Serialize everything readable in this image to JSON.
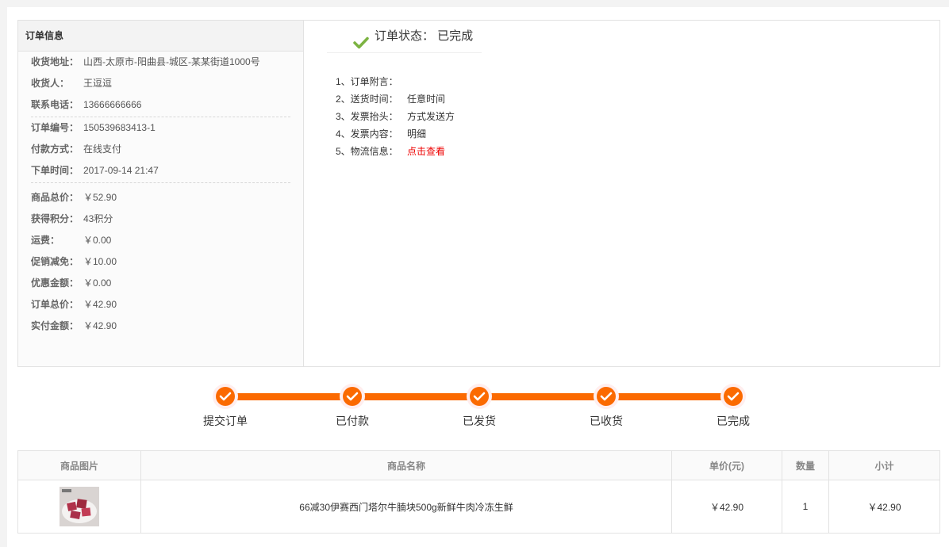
{
  "info": {
    "title": "订单信息",
    "group1": [
      {
        "k": "收货地址：",
        "v": "山西-太原市-阳曲县-城区-某某街道1000号"
      },
      {
        "k": "收货人：",
        "v": "王逗逗"
      },
      {
        "k": "联系电话：",
        "v": "13666666666"
      }
    ],
    "group2": [
      {
        "k": "订单编号：",
        "v": "150539683413-1"
      },
      {
        "k": "付款方式：",
        "v": "在线支付"
      },
      {
        "k": "下单时间：",
        "v": "2017-09-14 21:47"
      }
    ],
    "group3": [
      {
        "k": "商品总价：",
        "v": "￥52.90"
      },
      {
        "k": "获得积分：",
        "v": "43积分"
      },
      {
        "k": "运费：",
        "v": "￥0.00"
      },
      {
        "k": "促销减免：",
        "v": "￥10.00"
      },
      {
        "k": "优惠金额：",
        "v": "￥0.00"
      },
      {
        "k": "订单总价：",
        "v": "￥42.90"
      },
      {
        "k": "实付金额：",
        "v": "￥42.90"
      }
    ]
  },
  "status": {
    "label": "订单状态：  已完成",
    "items": [
      {
        "k": "1、订单附言：",
        "v": ""
      },
      {
        "k": "2、送货时间：",
        "v": "任意时间"
      },
      {
        "k": "3、发票抬头：",
        "v": "方式发送方"
      },
      {
        "k": "4、发票内容：",
        "v": "明细"
      },
      {
        "k": "5、物流信息：",
        "v": "点击查看"
      }
    ]
  },
  "steps": [
    "提交订单",
    "已付款",
    "已发货",
    "已收货",
    "已完成"
  ],
  "table": {
    "headers": [
      "商品图片",
      "商品名称",
      "单价(元)",
      "数量",
      "小计"
    ],
    "rows": [
      {
        "name": "66减30伊赛西门塔尔牛腩块500g新鲜牛肉冷冻生鲜",
        "price": "￥42.90",
        "qty": "1",
        "subtotal": "￥42.90"
      }
    ]
  },
  "colors": {
    "accent": "#fb6a00",
    "check": "#7cb342",
    "link": "#e00000"
  }
}
